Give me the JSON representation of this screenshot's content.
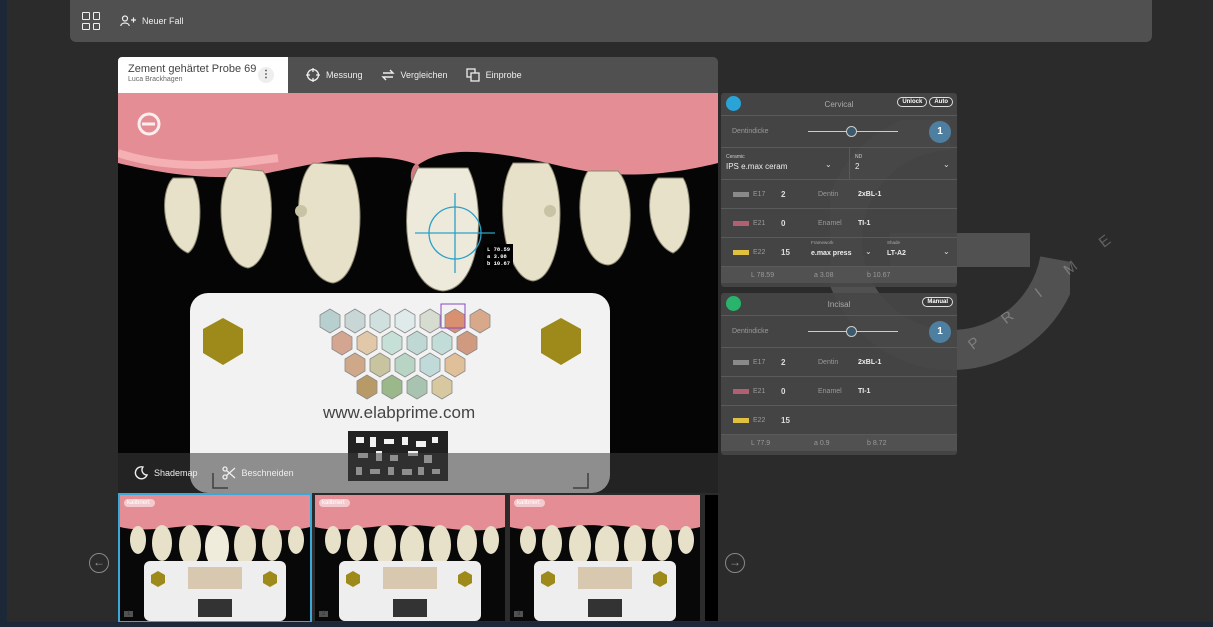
{
  "topbar": {
    "new_case_label": "Neuer Fall"
  },
  "case": {
    "title": "Zement gehärtet Probe 69",
    "author": "Luca Brackhagen"
  },
  "toolbar": {
    "measure": "Messung",
    "compare": "Vergleichen",
    "tryin": "Einprobe"
  },
  "photo": {
    "url_text": "www.elabprime.com",
    "lab_values": {
      "L": "L 78.59",
      "a": "a  3.08",
      "b": "b 10.67"
    },
    "shademap": "Shademap",
    "crop": "Beschneiden"
  },
  "thumbnails": [
    {
      "badge": "kalibriert",
      "index": "1"
    },
    {
      "badge": "kalibriert",
      "index": "2"
    },
    {
      "badge": "kalibriert",
      "index": "3"
    }
  ],
  "cervical": {
    "title": "Cervical",
    "unlock": "Unlock",
    "auto": "Auto",
    "dentin_label": "Dentindicke",
    "dentin_value": "1",
    "ceramic_label": "Ceramic",
    "ceramic_value": "IPS e.max ceram",
    "nd_label": "ND",
    "nd_value": "2",
    "shades": [
      {
        "name": "E17",
        "count": "2",
        "desc": "Dentin",
        "value": "2xBL-1",
        "color": "#8a8a8a"
      },
      {
        "name": "E21",
        "count": "0",
        "desc": "Enamel",
        "value": "TI-1",
        "color": "#b06070"
      },
      {
        "name": "E22",
        "count": "15",
        "color": "#e0c040"
      }
    ],
    "framework_label": "Framework",
    "framework_value": "e.max press",
    "shade_label": "Shade",
    "shade_value": "LT-A2",
    "L": "L  78.59",
    "a": "a  3.08",
    "b": "b  10.67"
  },
  "incisal": {
    "title": "Incisal",
    "manual": "Manual",
    "dentin_label": "Dentindicke",
    "dentin_value": "1",
    "shades": [
      {
        "name": "E17",
        "count": "2",
        "desc": "Dentin",
        "value": "2xBL-1",
        "color": "#8a8a8a"
      },
      {
        "name": "E21",
        "count": "0",
        "desc": "Enamel",
        "value": "TI-1",
        "color": "#b06070"
      },
      {
        "name": "E22",
        "count": "15",
        "color": "#e0c040"
      }
    ],
    "L": "L  77.9",
    "a": "a  0.9",
    "b": "b  8.72"
  },
  "watermark_text": "P R I M E"
}
